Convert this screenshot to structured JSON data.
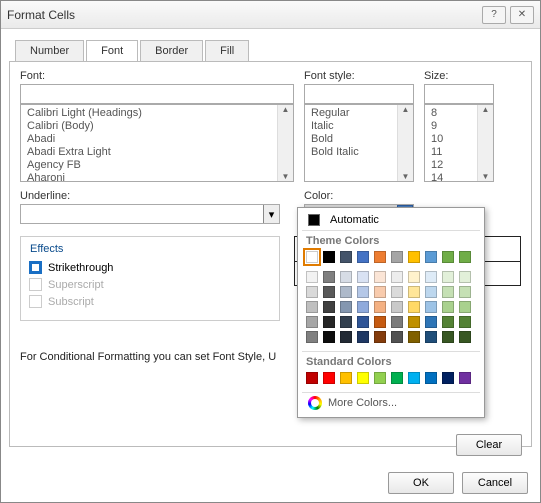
{
  "window": {
    "title": "Format Cells"
  },
  "tabs": {
    "number": "Number",
    "font": "Font",
    "border": "Border",
    "fill": "Fill"
  },
  "font": {
    "label": "Font:",
    "value": "",
    "items": [
      "Calibri Light (Headings)",
      "Calibri (Body)",
      "Abadi",
      "Abadi Extra Light",
      "Agency FB",
      "Aharoni"
    ]
  },
  "fontstyle": {
    "label": "Font style:",
    "value": "",
    "items": [
      "Regular",
      "Italic",
      "Bold",
      "Bold Italic"
    ]
  },
  "size": {
    "label": "Size:",
    "value": "",
    "items": [
      "8",
      "9",
      "10",
      "11",
      "12",
      "14"
    ]
  },
  "underline": {
    "label": "Underline:",
    "value": ""
  },
  "color": {
    "label": "Color:"
  },
  "effects": {
    "legend": "Effects",
    "strike": "Strikethrough",
    "superscript": "Superscript",
    "subscript": "Subscript"
  },
  "note": "For Conditional Formatting you can set Font Style, Underline, Color, and Strikethrough.",
  "note_truncated": "For Conditional Formatting you can set Font Style, U",
  "buttons": {
    "clear": "Clear",
    "ok": "OK",
    "cancel": "Cancel"
  },
  "popup": {
    "automatic": "Automatic",
    "theme": "Theme Colors",
    "standard": "Standard Colors",
    "more": "More Colors...",
    "theme_row": [
      "#ffffff",
      "#000000",
      "#44546a",
      "#4472c4",
      "#ed7d31",
      "#a5a5a5",
      "#ffc000",
      "#5b9bd5",
      "#70ad47",
      "#70ad47"
    ],
    "shades": [
      [
        "#f2f2f2",
        "#7f7f7f",
        "#d6dce5",
        "#d9e2f3",
        "#fbe5d6",
        "#ededed",
        "#fff2cc",
        "#deebf7",
        "#e2f0d9",
        "#e2f0d9"
      ],
      [
        "#d9d9d9",
        "#595959",
        "#adb9ca",
        "#b4c7e7",
        "#f8cbad",
        "#dbdbdb",
        "#ffe699",
        "#bdd7ee",
        "#c5e0b4",
        "#c5e0b4"
      ],
      [
        "#bfbfbf",
        "#404040",
        "#8497b0",
        "#8faadc",
        "#f4b183",
        "#c9c9c9",
        "#ffd966",
        "#9dc3e6",
        "#a9d18e",
        "#a9d18e"
      ],
      [
        "#a6a6a6",
        "#262626",
        "#323f4f",
        "#2f5597",
        "#c55a11",
        "#7b7b7b",
        "#bf9000",
        "#2e75b6",
        "#548235",
        "#548235"
      ],
      [
        "#808080",
        "#0d0d0d",
        "#222a35",
        "#1f3864",
        "#843c0c",
        "#525252",
        "#806000",
        "#1f4e79",
        "#385723",
        "#385723"
      ]
    ],
    "standard_row": [
      "#c00000",
      "#ff0000",
      "#ffc000",
      "#ffff00",
      "#92d050",
      "#00b050",
      "#00b0f0",
      "#0070c0",
      "#002060",
      "#7030a0"
    ]
  }
}
